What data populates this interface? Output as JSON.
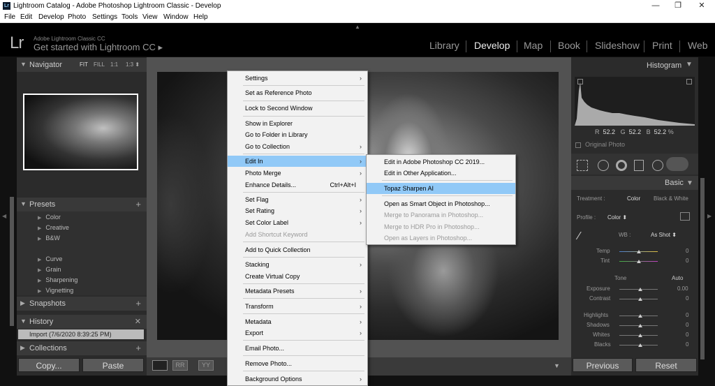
{
  "window": {
    "title": "Lightroom Catalog - Adobe Photoshop Lightroom Classic - Develop",
    "lr_icon": "Lr",
    "minimize": "—",
    "maximize": "❐",
    "close": "✕"
  },
  "menubar": [
    "File",
    "Edit",
    "Develop",
    "Photo",
    "Settings",
    "Tools",
    "View",
    "Window",
    "Help"
  ],
  "identity": {
    "logo": "Lr",
    "brand": "Adobe Lightroom Classic CC",
    "get_started": "Get started with Lightroom CC ▸"
  },
  "modules": [
    "Library",
    "Develop",
    "Map",
    "Book",
    "Slideshow",
    "Print",
    "Web"
  ],
  "active_module": "Develop",
  "left": {
    "navigator": {
      "title": "Navigator",
      "options": [
        "FIT",
        "FILL",
        "1:1",
        "1:3 ⬍"
      ]
    },
    "presets": {
      "title": "Presets",
      "items": [
        "Color",
        "Creative",
        "B&W",
        "Curve",
        "Grain",
        "Sharpening",
        "Vignetting"
      ]
    },
    "snapshots": {
      "title": "Snapshots"
    },
    "history": {
      "title": "History",
      "item": "Import (7/6/2020 8:39:25 PM)"
    },
    "collections": {
      "title": "Collections"
    },
    "copy": "Copy...",
    "paste": "Paste"
  },
  "right": {
    "histogram": {
      "title": "Histogram",
      "readout": {
        "R": "R",
        "r": "52.2",
        "G": "G",
        "g": "52.2",
        "B": "B",
        "b": "52.2",
        "pct": "%"
      },
      "original": "Original Photo"
    },
    "basic": {
      "title": "Basic",
      "treatment_label": "Treatment :",
      "treatment_color": "Color",
      "treatment_bw": "Black & White",
      "profile_label": "Profile :",
      "profile_value": "Color ⬍",
      "wb_label": "WB :",
      "wb_value": "As Shot ⬍",
      "sliders": [
        {
          "name": "Temp",
          "value": "0"
        },
        {
          "name": "Tint",
          "value": "0"
        }
      ],
      "tone": "Tone",
      "auto": "Auto",
      "tone_sliders": [
        {
          "name": "Exposure",
          "value": "0.00"
        },
        {
          "name": "Contrast",
          "value": "0"
        }
      ],
      "presence": [
        {
          "name": "Highlights",
          "value": "0"
        },
        {
          "name": "Shadows",
          "value": "0"
        },
        {
          "name": "Whites",
          "value": "0"
        },
        {
          "name": "Blacks",
          "value": "0"
        }
      ]
    },
    "previous": "Previous",
    "reset": "Reset"
  },
  "context_menu": {
    "items": [
      {
        "label": "Settings",
        "sub": "›"
      },
      {
        "label": "Set as Reference Photo"
      },
      {
        "label": "Lock to Second Window"
      },
      {
        "label": "Show in Explorer"
      },
      {
        "label": "Go to Folder in Library"
      },
      {
        "label": "Go to Collection",
        "sub": "›"
      },
      {
        "label": "Edit In",
        "sub": "›"
      },
      {
        "label": "Photo Merge",
        "sub": "›"
      },
      {
        "label": "Enhance Details...",
        "shortcut": "Ctrl+Alt+I"
      },
      {
        "label": "Set Flag",
        "sub": "›"
      },
      {
        "label": "Set Rating",
        "sub": "›"
      },
      {
        "label": "Set Color Label",
        "sub": "›"
      },
      {
        "label": "Add Shortcut Keyword"
      },
      {
        "label": "Add to Quick Collection"
      },
      {
        "label": "Stacking",
        "sub": "›"
      },
      {
        "label": "Create Virtual Copy"
      },
      {
        "label": "Metadata Presets",
        "sub": "›"
      },
      {
        "label": "Transform",
        "sub": "›"
      },
      {
        "label": "Metadata",
        "sub": "›"
      },
      {
        "label": "Export",
        "sub": "›"
      },
      {
        "label": "Email Photo..."
      },
      {
        "label": "Remove Photo..."
      },
      {
        "label": "Background Options",
        "sub": "›"
      }
    ]
  },
  "submenu": {
    "items": [
      {
        "label": "Edit in Adobe Photoshop CC 2019..."
      },
      {
        "label": "Edit in Other Application..."
      },
      {
        "label": "Topaz Sharpen AI"
      },
      {
        "label": "Open as Smart Object in Photoshop..."
      },
      {
        "label": "Merge to Panorama in Photoshop..."
      },
      {
        "label": "Merge to HDR Pro in Photoshop..."
      },
      {
        "label": "Open as Layers in Photoshop..."
      }
    ]
  },
  "toolbar": {
    "rr": "RR",
    "yy": "YY"
  },
  "colors": {
    "accent_highlight": "#91c9f7",
    "panel": "#2b2b2b",
    "center": "#525252"
  }
}
